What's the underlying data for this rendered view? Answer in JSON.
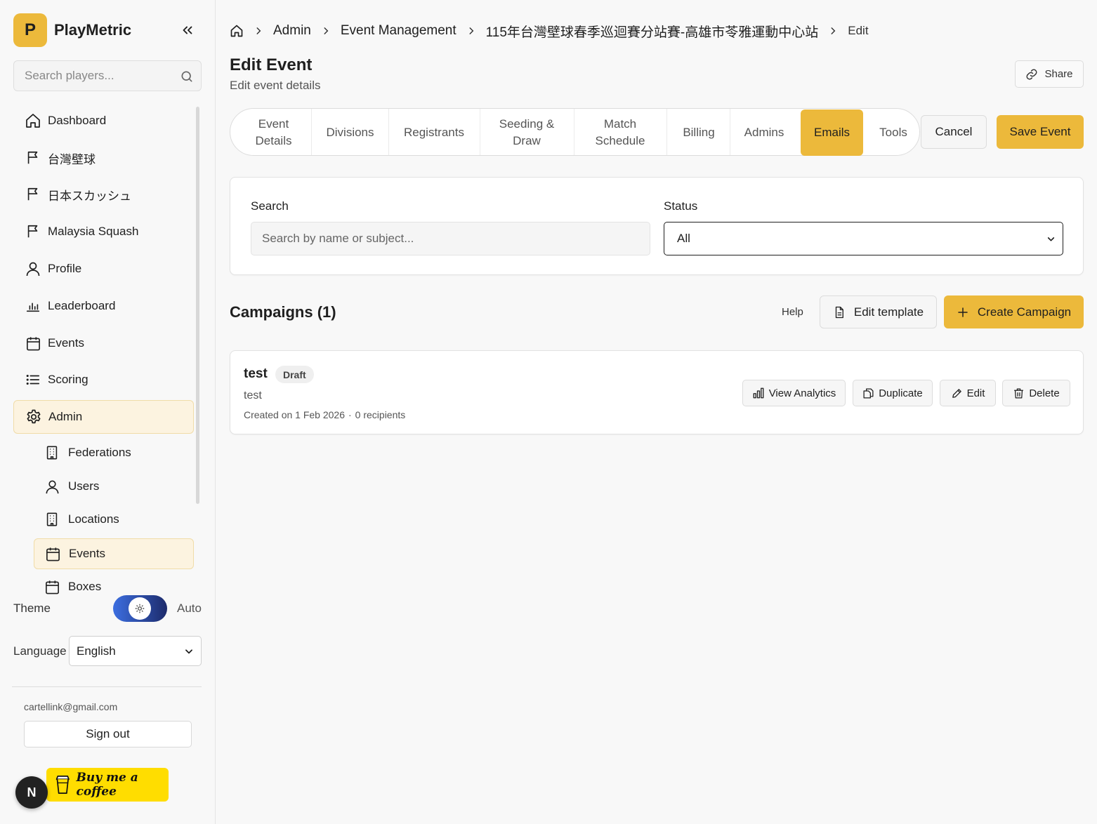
{
  "app": {
    "logo_letter": "P",
    "name": "PlayMetric"
  },
  "sidebar": {
    "search_placeholder": "Search players...",
    "items": [
      {
        "label": "Dashboard",
        "icon": "home-icon"
      },
      {
        "label": "台灣壁球",
        "icon": "flag-icon"
      },
      {
        "label": "日本スカッシュ",
        "icon": "flag-icon"
      },
      {
        "label": "Malaysia Squash",
        "icon": "flag-icon"
      },
      {
        "label": "Profile",
        "icon": "user-icon"
      },
      {
        "label": "Leaderboard",
        "icon": "bar-chart-icon"
      },
      {
        "label": "Events",
        "icon": "calendar-icon"
      },
      {
        "label": "Scoring",
        "icon": "list-icon"
      },
      {
        "label": "Admin",
        "icon": "gear-icon",
        "active": true
      }
    ],
    "sub_items": [
      {
        "label": "Federations",
        "icon": "building-icon"
      },
      {
        "label": "Users",
        "icon": "user-icon"
      },
      {
        "label": "Locations",
        "icon": "building-icon"
      },
      {
        "label": "Events",
        "icon": "calendar-icon",
        "active": true
      },
      {
        "label": "Boxes",
        "icon": "calendar-icon"
      }
    ],
    "theme_label": "Theme",
    "theme_value": "Auto",
    "language_label": "Language",
    "language_value": "English",
    "user_email": "cartellink@gmail.com",
    "sign_out": "Sign out",
    "next_badge": "N",
    "coffee_label": "Buy me a coffee"
  },
  "breadcrumb": {
    "items": [
      "Admin",
      "Event Management",
      "115年台灣壁球春季巡迴賽分站賽-高雄市苓雅運動中心站",
      "Edit"
    ]
  },
  "header": {
    "title": "Edit Event",
    "subtitle": "Edit event details",
    "share": "Share"
  },
  "tabs": [
    {
      "label": "Event\nDetails"
    },
    {
      "label": "Divisions"
    },
    {
      "label": "Registrants"
    },
    {
      "label": "Seeding &\nDraw"
    },
    {
      "label": "Match\nSchedule"
    },
    {
      "label": "Billing"
    },
    {
      "label": "Admins"
    },
    {
      "label": "Emails",
      "active": true
    },
    {
      "label": "Tools"
    }
  ],
  "actions": {
    "cancel": "Cancel",
    "save": "Save Event"
  },
  "filters": {
    "search_label": "Search",
    "search_placeholder": "Search by name or subject...",
    "status_label": "Status",
    "status_value": "All"
  },
  "campaigns": {
    "title": "Campaigns (1)",
    "help": "Help",
    "edit_template": "Edit template",
    "create": "Create Campaign",
    "items": [
      {
        "name": "test",
        "badge": "Draft",
        "subject": "test",
        "created": "Created on 1 Feb 2026",
        "recipients": "0 recipients",
        "separator": "·",
        "buttons": {
          "analytics": "View Analytics",
          "duplicate": "Duplicate",
          "edit": "Edit",
          "delete": "Delete"
        }
      }
    ]
  },
  "colors": {
    "accent": "#ecb93b",
    "active_bg": "#fcf3e0"
  }
}
